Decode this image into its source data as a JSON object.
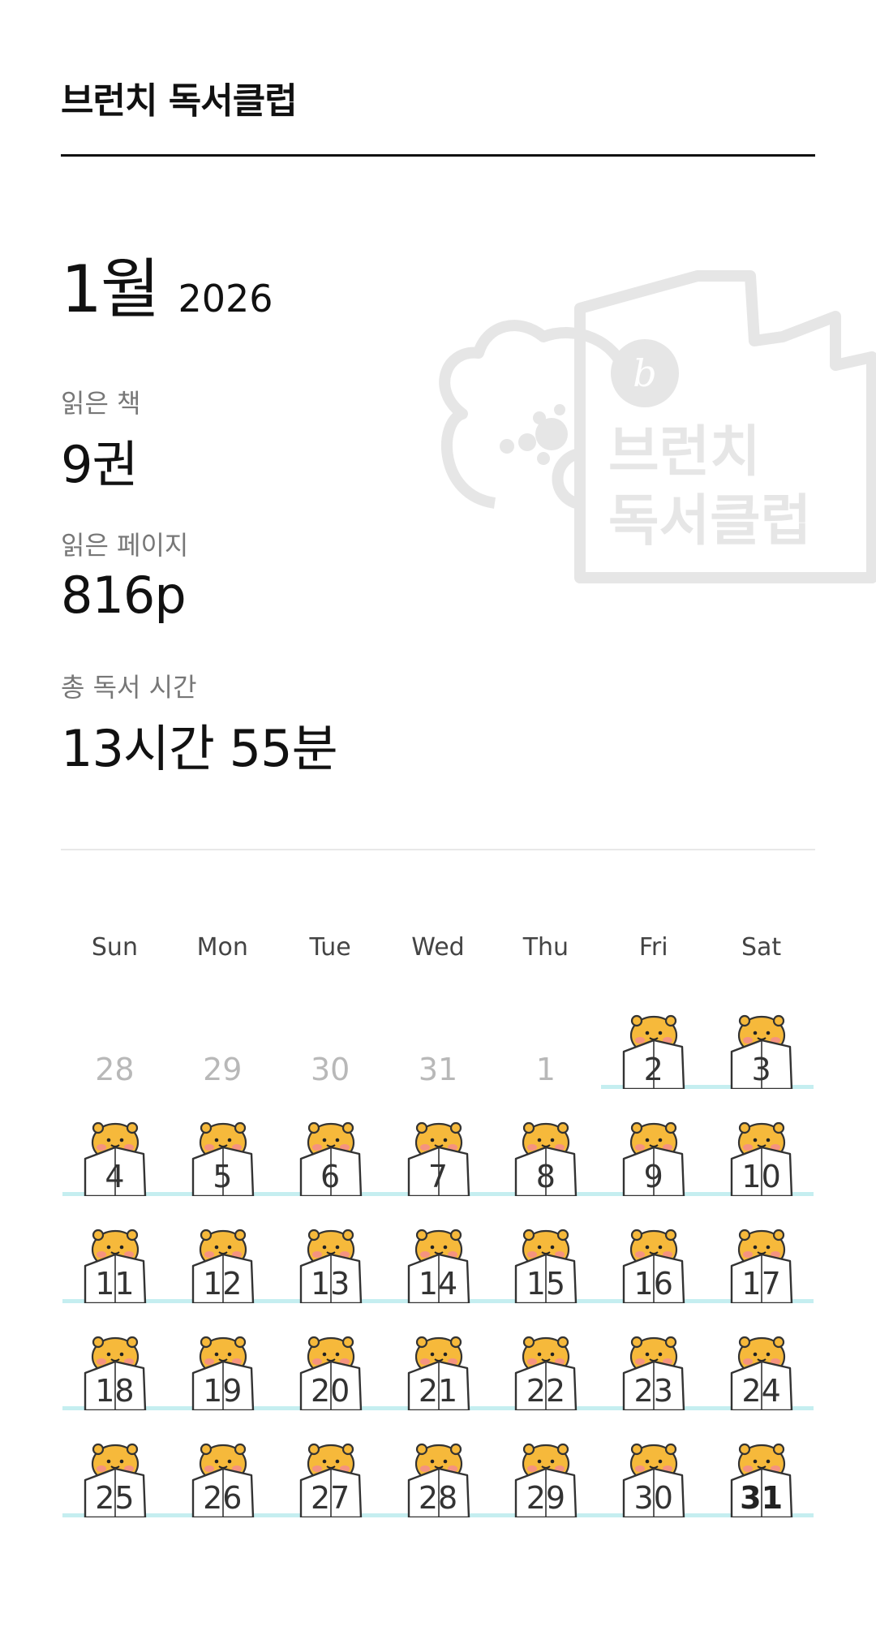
{
  "header": {
    "title": "브런치 독서클럽"
  },
  "watermark": {
    "line1": "브런치",
    "line2": "독서클럽",
    "logo_letter": "b"
  },
  "summary": {
    "month": "1월",
    "year": "2026",
    "books_label": "읽은 책",
    "books_value": "9권",
    "pages_label": "읽은 페이지",
    "pages_value": "816p",
    "time_label": "총 독서 시간",
    "time_value": "13시간 55분"
  },
  "calendar": {
    "weekdays": [
      "Sun",
      "Mon",
      "Tue",
      "Wed",
      "Thu",
      "Fri",
      "Sat"
    ],
    "weeks": [
      [
        {
          "d": "28",
          "muted": true,
          "read": false
        },
        {
          "d": "29",
          "muted": true,
          "read": false
        },
        {
          "d": "30",
          "muted": true,
          "read": false
        },
        {
          "d": "31",
          "muted": true,
          "read": false
        },
        {
          "d": "1",
          "muted": true,
          "read": false
        },
        {
          "d": "2",
          "muted": false,
          "read": true
        },
        {
          "d": "3",
          "muted": false,
          "read": true
        }
      ],
      [
        {
          "d": "4",
          "read": true
        },
        {
          "d": "5",
          "read": true
        },
        {
          "d": "6",
          "read": true
        },
        {
          "d": "7",
          "read": true
        },
        {
          "d": "8",
          "read": true
        },
        {
          "d": "9",
          "read": true
        },
        {
          "d": "10",
          "read": true
        }
      ],
      [
        {
          "d": "11",
          "read": true
        },
        {
          "d": "12",
          "read": true
        },
        {
          "d": "13",
          "read": true
        },
        {
          "d": "14",
          "read": true
        },
        {
          "d": "15",
          "read": true
        },
        {
          "d": "16",
          "read": true
        },
        {
          "d": "17",
          "read": true
        }
      ],
      [
        {
          "d": "18",
          "read": true
        },
        {
          "d": "19",
          "read": true
        },
        {
          "d": "20",
          "read": true
        },
        {
          "d": "21",
          "read": true
        },
        {
          "d": "22",
          "read": true
        },
        {
          "d": "23",
          "read": true
        },
        {
          "d": "24",
          "read": true
        }
      ],
      [
        {
          "d": "25",
          "read": true
        },
        {
          "d": "26",
          "read": true
        },
        {
          "d": "27",
          "read": true
        },
        {
          "d": "28",
          "read": true
        },
        {
          "d": "29",
          "read": true
        },
        {
          "d": "30",
          "read": true
        },
        {
          "d": "31",
          "read": true,
          "today": true
        }
      ]
    ]
  }
}
